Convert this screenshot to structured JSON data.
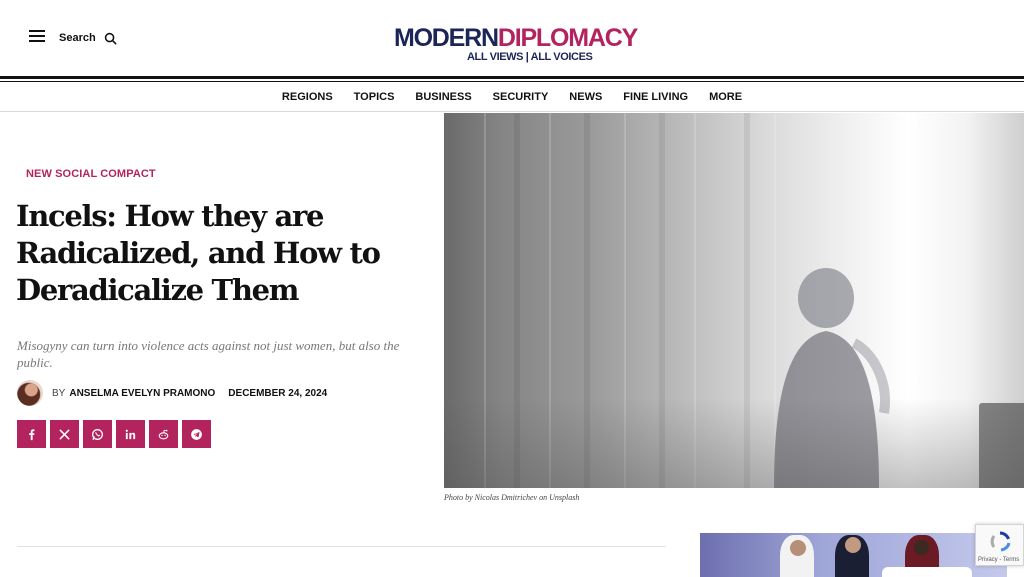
{
  "header": {
    "search_label": "Search",
    "logo": {
      "part_a": "MODERN",
      "part_b": "DIPLOMACY",
      "tagline": "ALL VIEWS | ALL VOICES"
    }
  },
  "nav": {
    "items": [
      {
        "label": "REGIONS"
      },
      {
        "label": "TOPICS"
      },
      {
        "label": "BUSINESS"
      },
      {
        "label": "SECURITY"
      },
      {
        "label": "NEWS"
      },
      {
        "label": "FINE LIVING"
      },
      {
        "label": "MORE"
      }
    ]
  },
  "article": {
    "category": "NEW SOCIAL COMPACT",
    "title": "Incels: How they are Radicalized, and How to Deradicalize Them",
    "dek": "Misogyny can turn into violence acts against not just women, but also the public.",
    "byline_prefix": "BY",
    "author": "ANSELMA EVELYN PRAMONO",
    "date": "DECEMBER 24, 2024",
    "image_caption": "Photo by Nicolas Dmitrichev on Unsplash"
  },
  "share": {
    "buttons": [
      {
        "network": "facebook",
        "icon": "facebook-icon"
      },
      {
        "network": "x",
        "icon": "x-icon"
      },
      {
        "network": "whatsapp",
        "icon": "whatsapp-icon"
      },
      {
        "network": "linkedin",
        "icon": "linkedin-icon"
      },
      {
        "network": "reddit",
        "icon": "reddit-icon"
      },
      {
        "network": "telegram",
        "icon": "telegram-icon"
      }
    ]
  },
  "recaptcha": {
    "links": "Privacy - Terms"
  },
  "colors": {
    "brand_navy": "#1c2557",
    "brand_magenta": "#b3245e",
    "text": "#111111",
    "dek_gray": "#777777"
  }
}
